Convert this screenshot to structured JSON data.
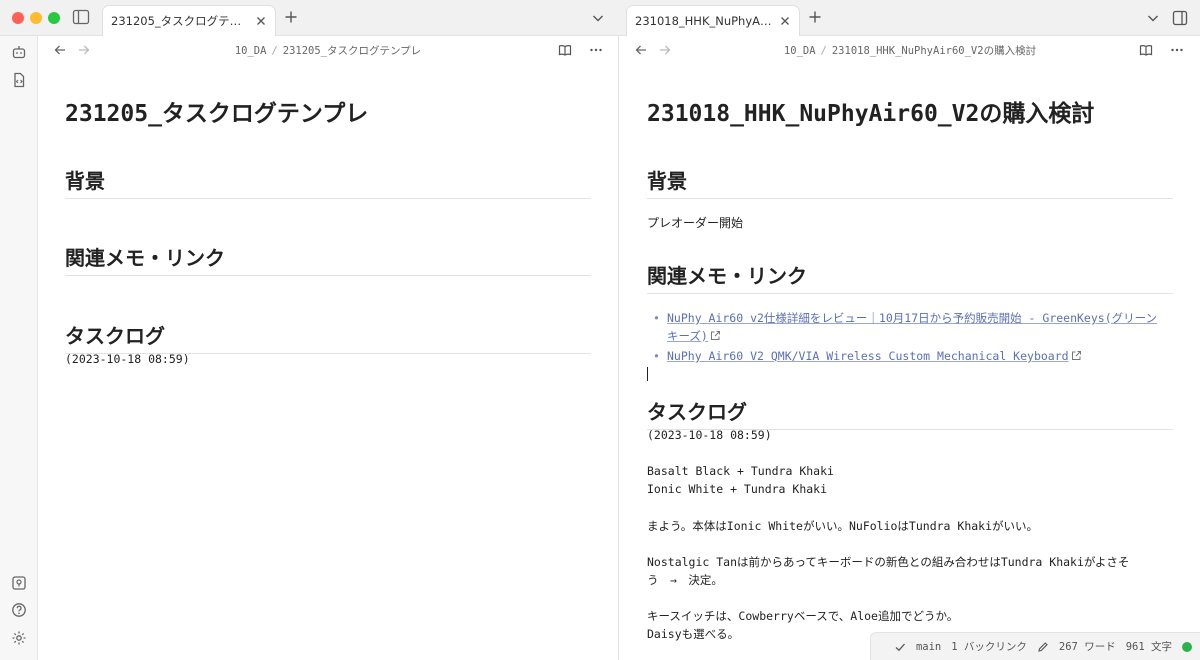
{
  "tabs": [
    {
      "label": "231205_タスクログテンプレ"
    },
    {
      "label": "231018_HHK_NuPhyAir60_V2の購入検討"
    }
  ],
  "left_pane": {
    "breadcrumb": {
      "folder": "10_DA",
      "note": "231205_タスクログテンプレ"
    },
    "title": "231205_タスクログテンプレ",
    "sections": {
      "background": "背景",
      "related": "関連メモ・リンク",
      "tasklog": "タスクログ"
    },
    "timestamp": "(2023-10-18 08:59)"
  },
  "right_pane": {
    "breadcrumb": {
      "folder": "10_DA",
      "note": "231018_HHK_NuPhyAir60_V2の購入検討"
    },
    "title": "231018_HHK_NuPhyAir60_V2の購入検討",
    "sections": {
      "background": "背景",
      "related": "関連メモ・リンク",
      "tasklog": "タスクログ"
    },
    "background_text": "プレオーダー開始",
    "links": [
      {
        "line1": "NuPhy Air60 v2仕様詳細をレビュー｜10月17日から予約販売開始 - GreenKeys(グリーン",
        "line2": "キーズ)"
      },
      {
        "line1": "NuPhy Air60 V2 QMK/VIA Wireless Custom Mechanical Keyboard"
      }
    ],
    "timestamp": "(2023-10-18 08:59)",
    "log_lines": [
      "Basalt Black + Tundra Khaki",
      "Ionic White + Tundra Khaki",
      "まよう。本体はIonic Whiteがいい。NuFolioはTundra Khakiがいい。",
      "Nostalgic Tanは前からあってキーボードの新色との組み合わせはTundra Khakiがよさそ",
      "う　→　決定。",
      "キースイッチは、Cowberryベースで、Aloe追加でどうか。",
      "Daisyも選べる。"
    ]
  },
  "statusbar": {
    "branch": "main",
    "backlinks": "1 バックリンク",
    "words": "267 ワード",
    "chars": "961 文字",
    "sync_color": "#2bb24c"
  },
  "icons": {
    "sidebar_toggle": "sidebar-toggle-icon",
    "close": "close-icon",
    "plus": "plus-icon",
    "chevron_down": "chevron-down-icon",
    "right_sidebar": "right-sidebar-icon",
    "back": "arrow-left-icon",
    "forward": "arrow-right-icon",
    "reading_view": "book-open-icon",
    "more": "more-options-icon",
    "external_link": "external-link-icon"
  }
}
